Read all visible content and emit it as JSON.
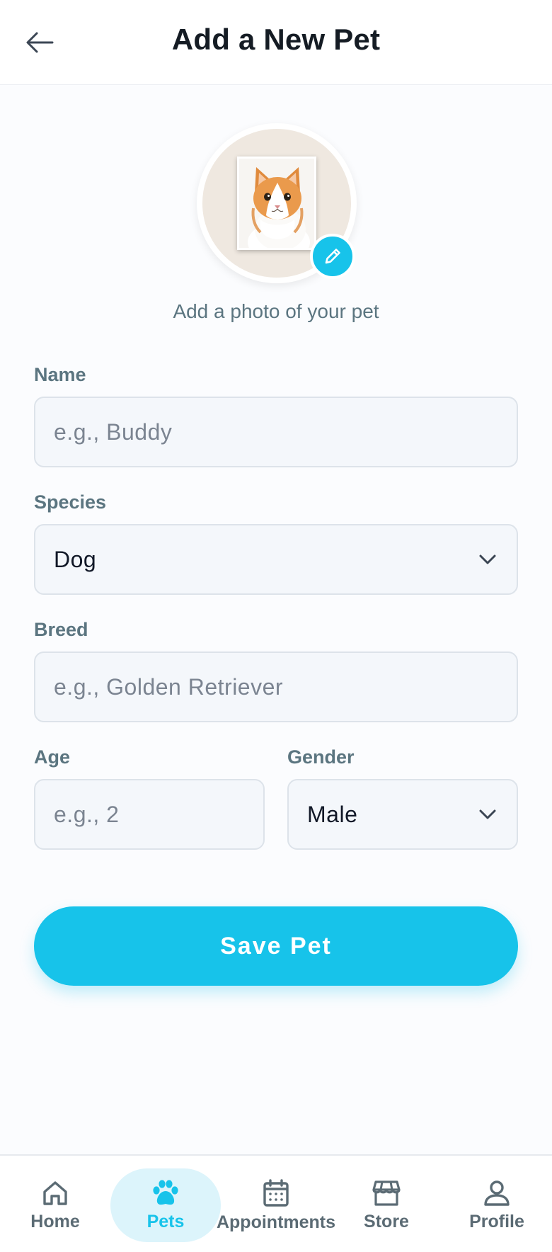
{
  "header": {
    "title": "Add a New Pet",
    "back_icon": "arrow-left-icon"
  },
  "photo": {
    "caption": "Add a photo of your pet",
    "edit_icon": "pencil-icon",
    "accent_color": "#17c3ea"
  },
  "form": {
    "name": {
      "label": "Name",
      "placeholder": "e.g., Buddy"
    },
    "species": {
      "label": "Species",
      "value": "Dog"
    },
    "breed": {
      "label": "Breed",
      "placeholder": "e.g., Golden Retriever"
    },
    "age": {
      "label": "Age",
      "placeholder": "e.g., 2"
    },
    "gender": {
      "label": "Gender",
      "value": "Male"
    },
    "save_label": "Save Pet"
  },
  "nav": {
    "items": [
      {
        "label": "Home",
        "icon": "home-icon",
        "active": false
      },
      {
        "label": "Pets",
        "icon": "paw-icon",
        "active": true
      },
      {
        "label": "Appointments",
        "icon": "calendar-icon",
        "active": false
      },
      {
        "label": "Store",
        "icon": "store-icon",
        "active": false
      },
      {
        "label": "Profile",
        "icon": "user-icon",
        "active": false
      }
    ]
  }
}
